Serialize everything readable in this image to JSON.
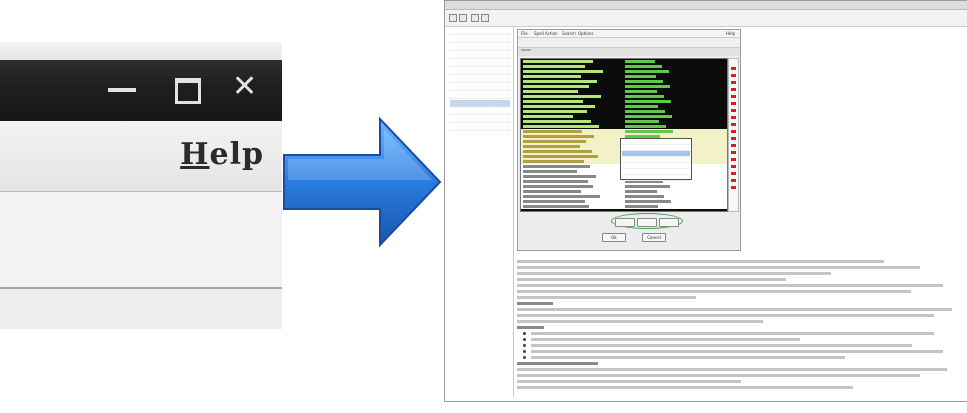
{
  "zoom": {
    "window_controls": {
      "minimize": "_",
      "maximize": "□",
      "close": "✕"
    },
    "menu": {
      "help_mnemonic": "H",
      "help_rest": "elp"
    }
  },
  "arrow": {
    "color": "#2a7be0"
  },
  "mini": {
    "window_title": "",
    "menu_items": [
      "File",
      "Spell Action",
      "Search",
      "Options",
      "Help"
    ],
    "sidebar_items": [
      "",
      "",
      "",
      "",
      "",
      "",
      "",
      "",
      "",
      "",
      "",
      "",
      ""
    ],
    "tab_label": "",
    "buttons": {
      "ok": "Ok",
      "cancel": "Cancel"
    },
    "option_buttons": [
      "",
      "",
      ""
    ]
  }
}
